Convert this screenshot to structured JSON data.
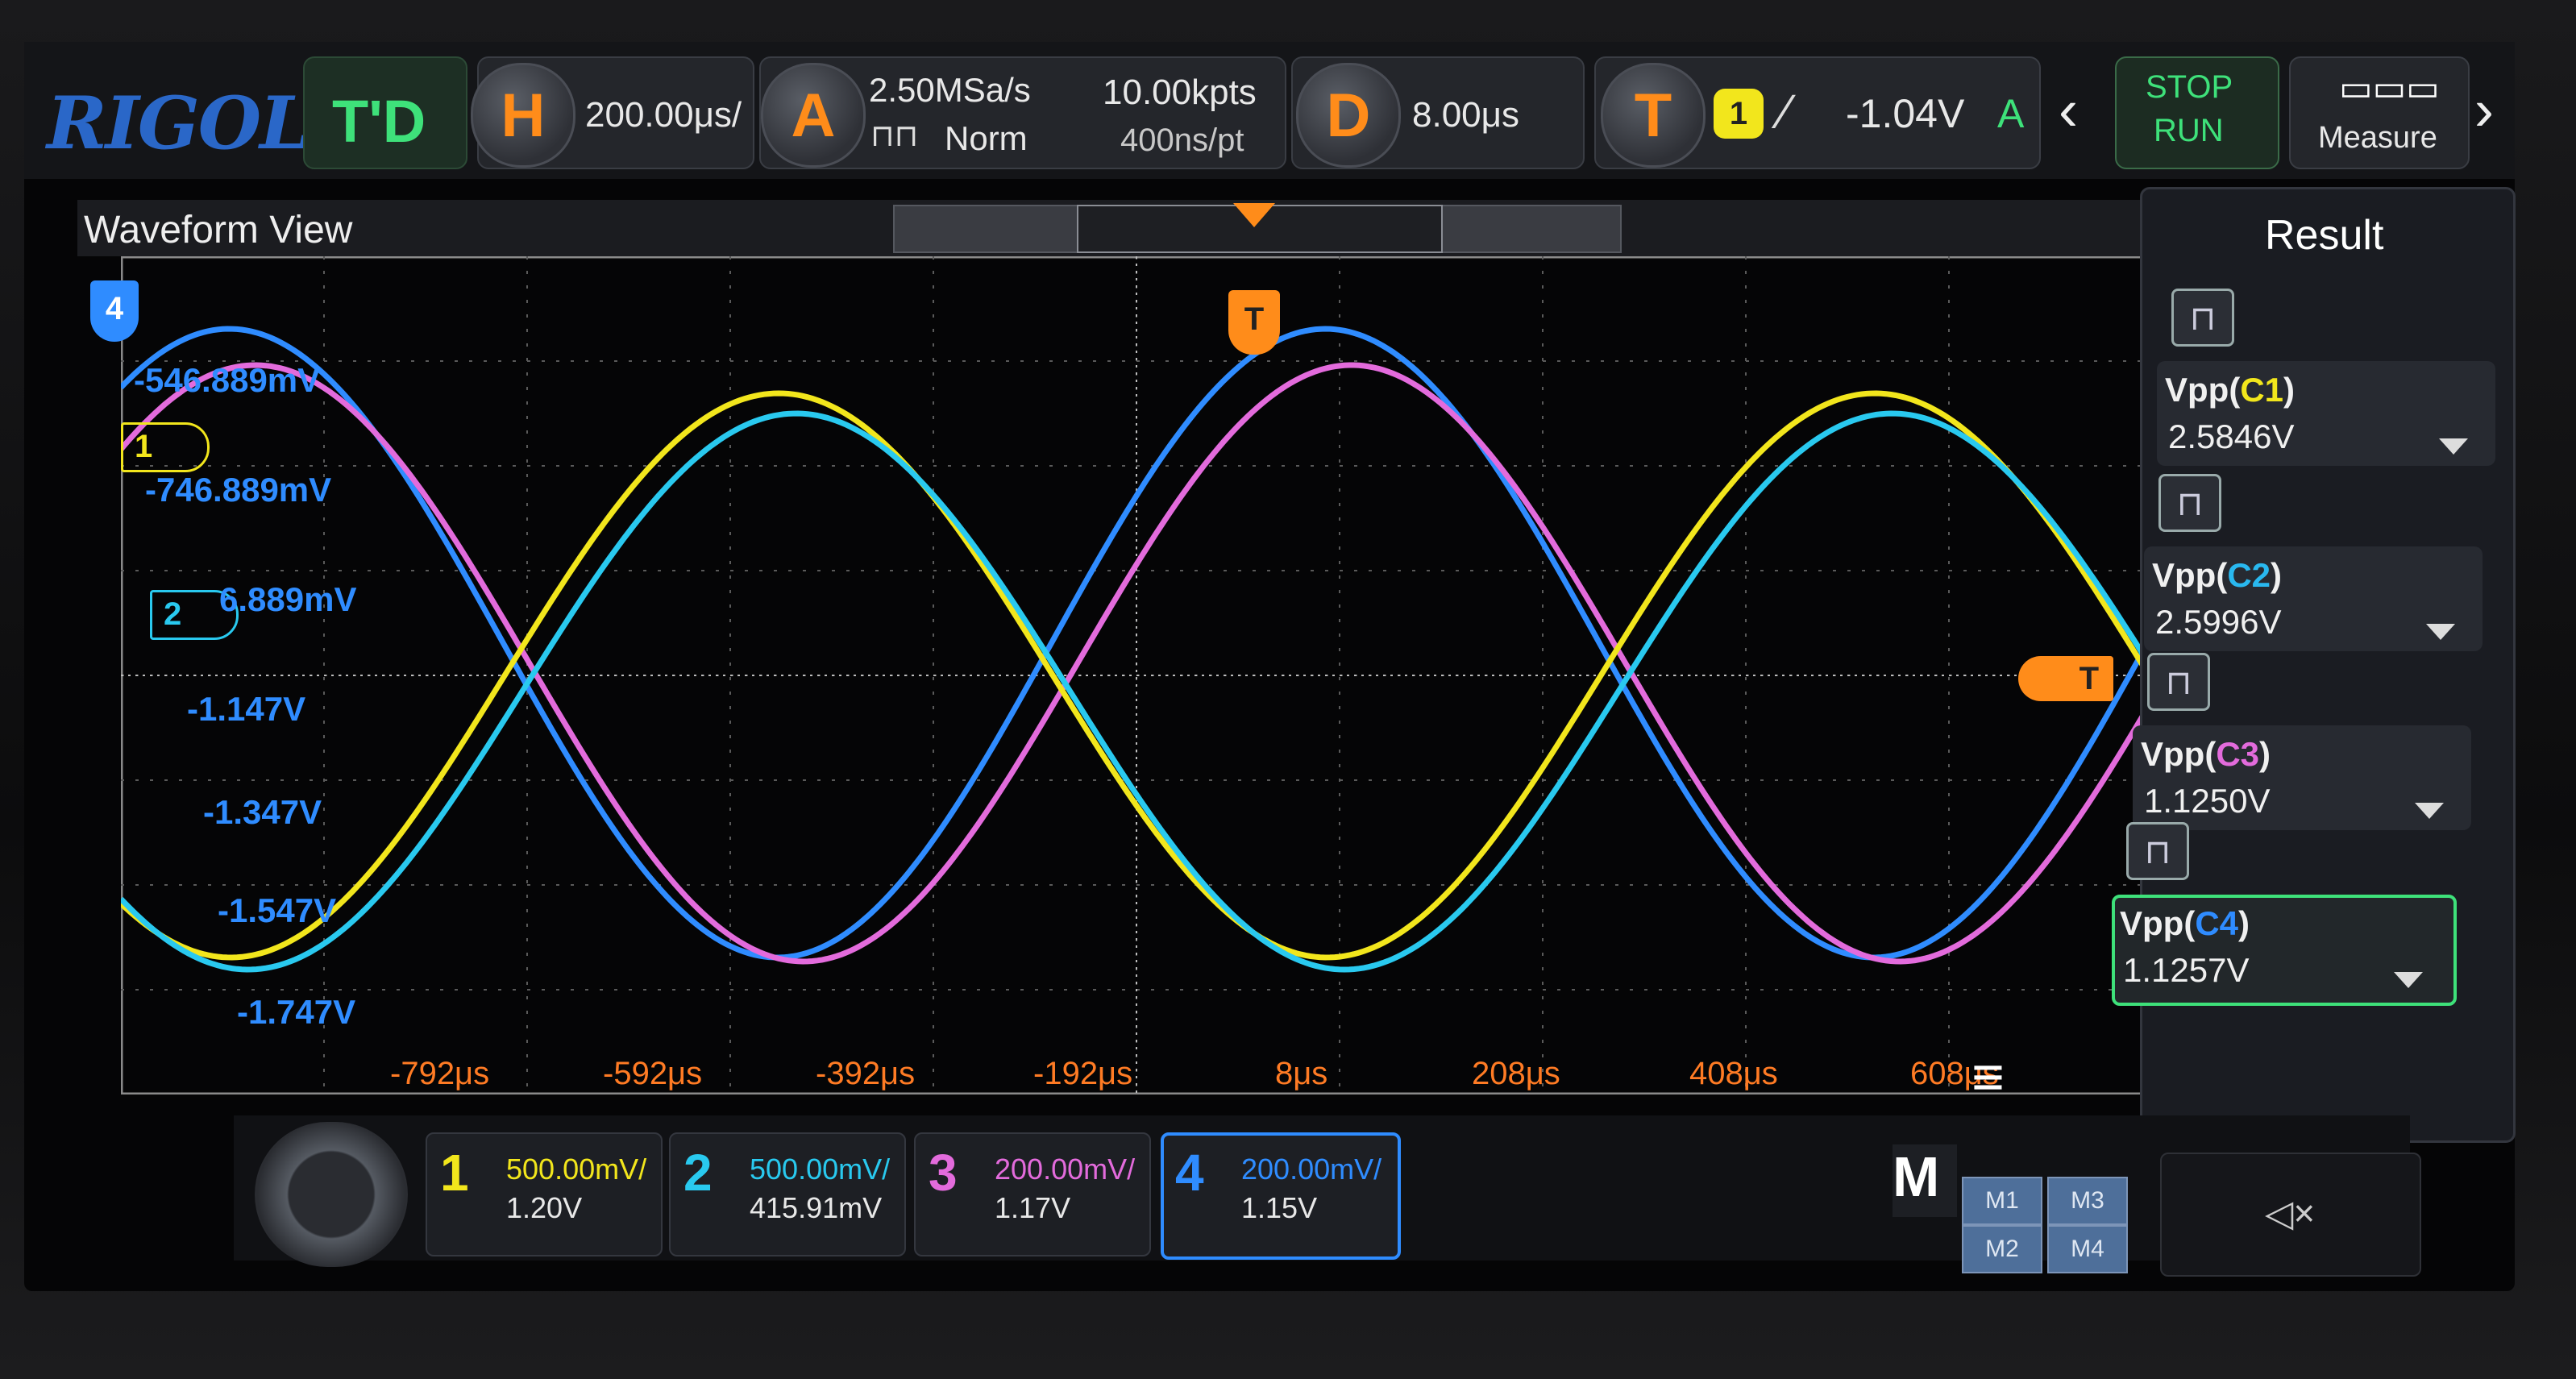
{
  "brand": "RIGOL",
  "mode": "T'D",
  "horizontal": {
    "icon": "H",
    "scale": "200.00μs/"
  },
  "acquire": {
    "icon": "A",
    "sample_rate": "2.50MSa/s",
    "mode": "Norm",
    "memory": "10.00kpts",
    "per_point": "400ns/pt"
  },
  "delay": {
    "icon": "D",
    "value": "8.00μs"
  },
  "trigger": {
    "icon": "T",
    "source": "1",
    "level": "-1.04V",
    "sweep": "A"
  },
  "run_control": {
    "stop": "STOP",
    "run": "RUN"
  },
  "measure_button": "Measure",
  "waveform_view_title": "Waveform View",
  "trigger_marker": "T",
  "channel4_marker": "4",
  "channel1_marker": "1",
  "channel2_marker": "2",
  "voltage_labels": [
    "-546.889mV",
    "-746.889mV",
    "6.889mV",
    "-1.147V",
    "-1.347V",
    "-1.547V",
    "-1.747V"
  ],
  "time_labels": [
    "-792μs",
    "-592μs",
    "-392μs",
    "-192μs",
    "8μs",
    "208μs",
    "408μs",
    "608μs"
  ],
  "results": {
    "title": "Result",
    "items": [
      {
        "name": "Vpp(",
        "ch": "C1",
        "close": ")",
        "value": "2.5846V",
        "ch_color": "#f2e61c"
      },
      {
        "name": "Vpp(",
        "ch": "C2",
        "close": ")",
        "value": "2.5996V",
        "ch_color": "#29b8ef"
      },
      {
        "name": "Vpp(",
        "ch": "C3",
        "close": ")",
        "value": "1.1250V",
        "ch_color": "#e36bdc"
      },
      {
        "name": "Vpp(",
        "ch": "C4",
        "close": ")",
        "value": "1.1257V",
        "ch_color": "#2f8cff"
      }
    ]
  },
  "channels": [
    {
      "num": "1",
      "scale": "500.00mV/",
      "offset": "1.20V",
      "color": "#f2e61c"
    },
    {
      "num": "2",
      "scale": "500.00mV/",
      "offset": "415.91mV",
      "color": "#29c9ef"
    },
    {
      "num": "3",
      "scale": "200.00mV/",
      "offset": "1.17V",
      "color": "#e36bdc"
    },
    {
      "num": "4",
      "scale": "200.00mV/",
      "offset": "1.15V",
      "color": "#2f8cff"
    }
  ],
  "math": {
    "label": "M",
    "m1": "M1",
    "m2": "M2",
    "m3": "M3",
    "m4": "M4"
  },
  "colors": {
    "ch1": "#f2e61c",
    "ch2": "#29c9ef",
    "ch3": "#e36bdc",
    "ch4": "#2f8cff",
    "accent": "#ff8c1a",
    "run_green": "#3ee17a"
  }
}
